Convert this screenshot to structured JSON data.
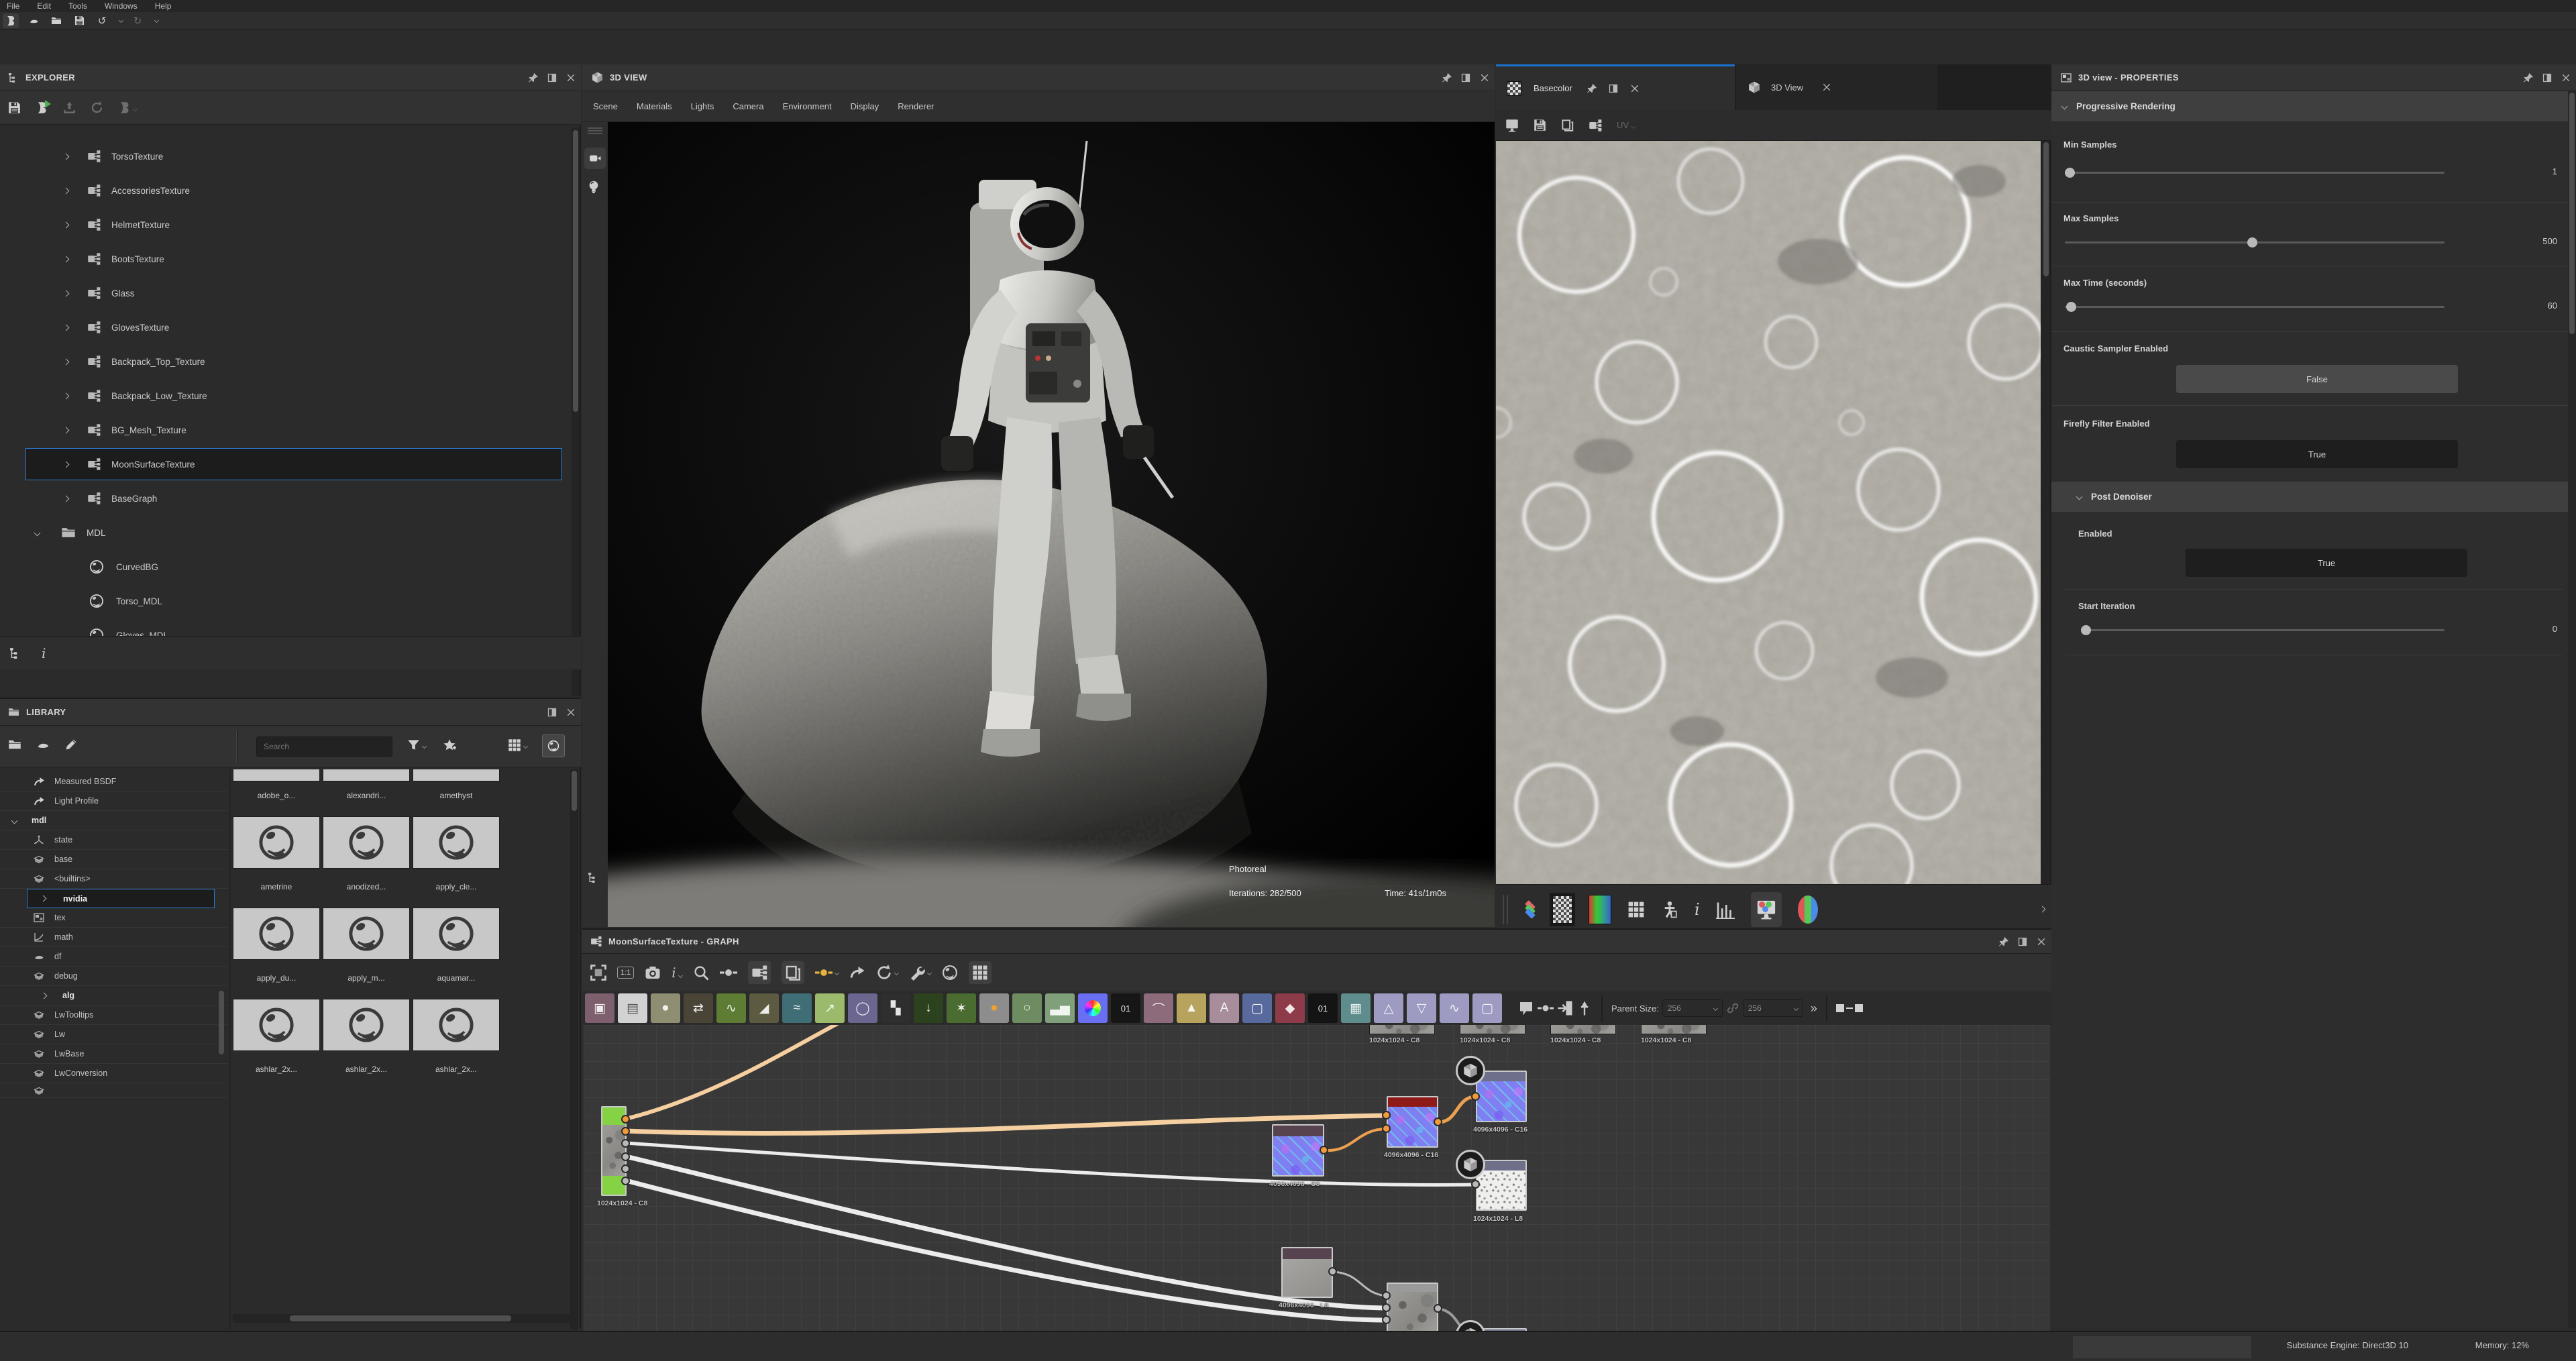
{
  "colors": {
    "accent_blue": "#1a73d4",
    "selection_border": "#2b7cd3",
    "wire_peach": "#f6cfa0",
    "wire_orange": "#eda04f",
    "node_green": "#86d245",
    "status_red": "#8e1a1a"
  },
  "menubar": {
    "items": [
      "File",
      "Edit",
      "Tools",
      "Windows",
      "Help"
    ]
  },
  "main_toolbar": {
    "icons": [
      "new-substance-icon",
      "new-mdl-icon",
      "open-icon",
      "save-icon",
      "undo-icon",
      "undo-dropdown-icon",
      "redo-icon",
      "redo-dropdown-icon"
    ],
    "undo_glyph": "↺",
    "redo_glyph": "↻"
  },
  "explorer": {
    "title": "EXPLORER",
    "toolbar_icons": [
      "save-icon",
      "substance-play-icon",
      "export-icon",
      "reload-icon",
      "link-icon"
    ],
    "items": [
      {
        "label": "TorsoTexture"
      },
      {
        "label": "AccessoriesTexture"
      },
      {
        "label": "HelmetTexture"
      },
      {
        "label": "BootsTexture"
      },
      {
        "label": "Glass"
      },
      {
        "label": "GlovesTexture"
      },
      {
        "label": "Backpack_Top_Texture"
      },
      {
        "label": "Backpack_Low_Texture"
      },
      {
        "label": "BG_Mesh_Texture"
      },
      {
        "label": "MoonSurfaceTexture",
        "selected": true
      },
      {
        "label": "BaseGraph"
      }
    ],
    "folder": {
      "label": "MDL",
      "children": [
        {
          "label": "CurvedBG"
        },
        {
          "label": "Torso_MDL"
        },
        {
          "label": "Gloves_MDL"
        }
      ]
    },
    "bottom_tabs": [
      "tree-icon",
      "info-icon"
    ],
    "info_glyph": "i"
  },
  "library": {
    "title": "LIBRARY",
    "toolbar_icons": [
      "new-folder-icon",
      "new-mdl-icon",
      "edit-pencil-icon",
      "filter-icon",
      "favorite-add-icon",
      "grid-view-icon",
      "thumbnail-view-icon"
    ],
    "search": {
      "placeholder": "Search"
    },
    "categories": [
      {
        "label": "Measured BSDF"
      },
      {
        "label": "Light Profile"
      },
      {
        "label": "mdl",
        "bold": true,
        "expanded": true
      },
      {
        "label": "state"
      },
      {
        "label": "base"
      },
      {
        "label": "<builtins>"
      },
      {
        "label": "nvidia",
        "bold": true,
        "selected": true
      },
      {
        "label": "tex"
      },
      {
        "label": "math"
      },
      {
        "label": "df"
      },
      {
        "label": "debug"
      },
      {
        "label": "alg",
        "bold": true
      },
      {
        "label": "LwTooltips"
      },
      {
        "label": "Lw"
      },
      {
        "label": "LwBase"
      },
      {
        "label": "LwConversion"
      }
    ],
    "thumbnails": [
      "adobe_o...",
      "alexandri...",
      "amethyst",
      "ametrine",
      "anodized...",
      "apply_cle...",
      "apply_du...",
      "apply_m...",
      "aquamar...",
      "ashlar_2x...",
      "ashlar_2x...",
      "ashlar_2x..."
    ]
  },
  "view3d": {
    "title": "3D VIEW",
    "menu": [
      "Scene",
      "Materials",
      "Lights",
      "Camera",
      "Environment",
      "Display",
      "Renderer"
    ],
    "side_icons": [
      "video-camera-icon",
      "lightbulb-icon",
      "scene-tree-icon"
    ],
    "renderer_name": "Photoreal",
    "iterations": "Iterations: 282/500",
    "time": "Time: 41s/1m0s"
  },
  "view2d": {
    "active_tab": "Basecolor",
    "inactive_tab": "3D View",
    "toolbar_icons": [
      "export-image-icon",
      "save-icon",
      "copy-icon",
      "graph-link-icon"
    ],
    "uv_label": "UV",
    "bottom_icons": [
      "layers-icon",
      "alpha-checker-icon",
      "gradient-icon",
      "tiling-grid-icon",
      "mannequin-icon",
      "info-icon",
      "histogram-icon",
      "rgb-monitor-icon",
      "rgb-sphere-icon"
    ]
  },
  "properties": {
    "title": "3D view - PROPERTIES",
    "section_progressive": "Progressive Rendering",
    "min_samples": {
      "label": "Min Samples",
      "value": "1"
    },
    "max_samples": {
      "label": "Max Samples",
      "value": "500"
    },
    "max_time": {
      "label": "Max Time (seconds)",
      "value": "60"
    },
    "caustic": {
      "label": "Caustic Sampler Enabled",
      "value": "False"
    },
    "firefly": {
      "label": "Firefly Filter Enabled",
      "value": "True"
    },
    "section_denoiser": "Post Denoiser",
    "enabled": {
      "label": "Enabled",
      "value": "True"
    },
    "start_iteration": {
      "label": "Start Iteration",
      "value": "0"
    }
  },
  "graph": {
    "title": "MoonSurfaceTexture - GRAPH",
    "toolbar_icons": [
      "fit-frame-icon",
      "actual-size-icon",
      "snapshot-icon",
      "info-icon",
      "loupe-icon",
      "link-display-icon",
      "graph-icon",
      "layers-icon",
      "link-create-icon",
      "connector-icon",
      "timing-icon",
      "tools-icon",
      "material-icon",
      "snap-grid-icon"
    ],
    "parent_size_label": "Parent Size:",
    "width_value": "256",
    "height_value": "256",
    "more_glyph": "»",
    "mini_labels": [
      "1024x1024 - C8",
      "1024x1024 - C8",
      "1024x1024 - C8",
      "1024x1024 - C8"
    ],
    "node_labels": {
      "a": "1024x1024 - C8",
      "b": "4096x4096 - C8",
      "c": "4096x4096 - C16",
      "d": "4096x4096 - C16",
      "e": "1024x1024 - L8",
      "f": "4096x4096 - L8"
    }
  },
  "statusbar": {
    "engine": "Substance Engine: Direct3D 10",
    "memory": "Memory: 12%"
  }
}
